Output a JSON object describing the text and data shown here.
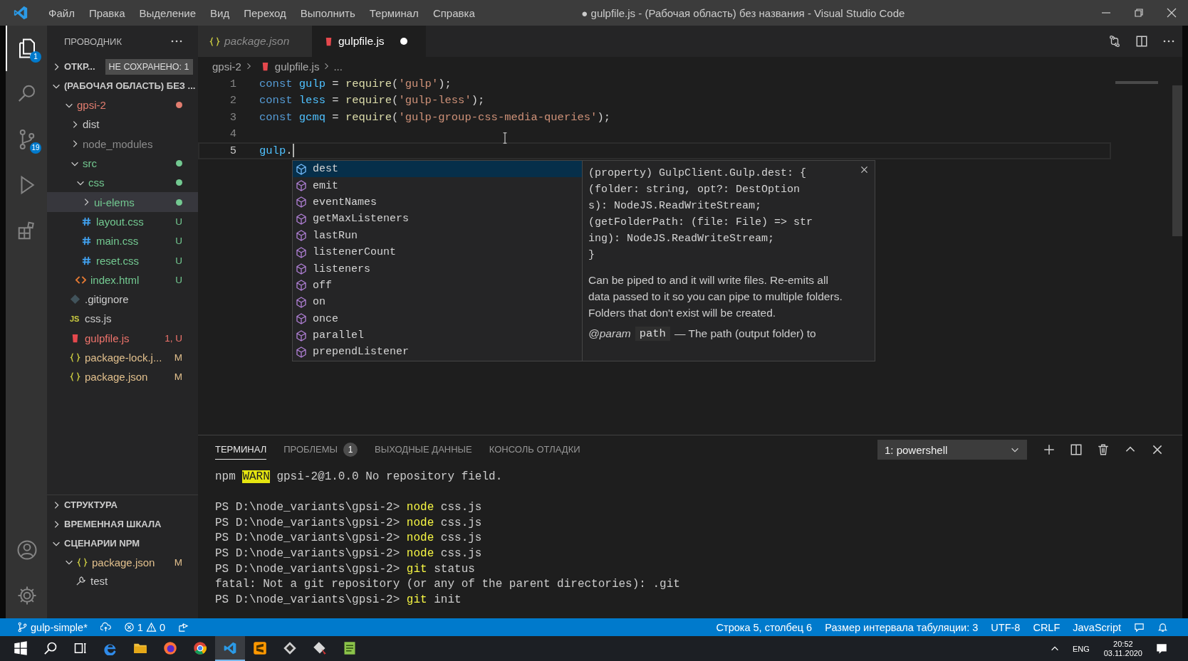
{
  "window": {
    "title": "● gulpfile.js - (Рабочая область) без названия - Visual Studio Code"
  },
  "menu": [
    "Файл",
    "Правка",
    "Выделение",
    "Вид",
    "Переход",
    "Выполнить",
    "Терминал",
    "Справка"
  ],
  "activity_bar": [
    {
      "kind": "explorer",
      "selected": true,
      "badge": "1"
    },
    {
      "kind": "search",
      "selected": false
    },
    {
      "kind": "source-control",
      "selected": false,
      "badge": "19"
    },
    {
      "kind": "run",
      "selected": false
    },
    {
      "kind": "extensions",
      "selected": false
    }
  ],
  "activity_bar_bottom": [
    {
      "kind": "account"
    },
    {
      "kind": "settings"
    }
  ],
  "sidebar": {
    "title": "ПРОВОДНИК",
    "open_editors": {
      "label": "ОТКР...",
      "expanded": false,
      "badge": "НЕ СОХРАНЕНО: 1"
    },
    "workspace": {
      "label": "(РАБОЧАЯ ОБЛАСТЬ) БЕЗ ...",
      "expanded": true
    },
    "tree": [
      {
        "name": "gpsi-2",
        "kind": "folder",
        "expanded": true,
        "selected": false,
        "color": "#e27d6f",
        "dot": true,
        "children": [
          {
            "name": "dist",
            "kind": "folder",
            "expanded": false,
            "selected": false,
            "color": "#cccccc"
          },
          {
            "name": "node_modules",
            "kind": "folder",
            "expanded": false,
            "selected": false,
            "color": "#8c8c8c"
          },
          {
            "name": "src",
            "kind": "folder",
            "expanded": true,
            "selected": false,
            "color": "#73c991",
            "dot": true,
            "children": [
              {
                "name": "css",
                "kind": "folder",
                "expanded": true,
                "selected": false,
                "color": "#73c991",
                "dot": true,
                "children": [
                  {
                    "name": "ui-elems",
                    "kind": "folder",
                    "expanded": false,
                    "selected": true,
                    "color": "#73c991",
                    "dot": true
                  },
                  {
                    "name": "layout.css",
                    "kind": "css",
                    "selected": false,
                    "color": "#73c991",
                    "status": "U"
                  },
                  {
                    "name": "main.css",
                    "kind": "css",
                    "selected": false,
                    "color": "#73c991",
                    "status": "U"
                  },
                  {
                    "name": "reset.css",
                    "kind": "css",
                    "selected": false,
                    "color": "#73c991",
                    "status": "U"
                  }
                ]
              },
              {
                "name": "index.html",
                "kind": "html",
                "selected": false,
                "color": "#73c991",
                "status": "U"
              }
            ]
          },
          {
            "name": ".gitignore",
            "kind": "git",
            "selected": false,
            "color": "#cccccc"
          },
          {
            "name": "css.js",
            "kind": "js",
            "icon_text": "JS",
            "selected": false,
            "color": "#cccccc"
          },
          {
            "name": "gulpfile.js",
            "kind": "gulp",
            "selected": false,
            "color": "#f0746c",
            "status": "1, U"
          },
          {
            "name": "package-lock.j...",
            "kind": "json",
            "selected": false,
            "color": "#e2c08d",
            "status": "M"
          },
          {
            "name": "package.json",
            "kind": "json",
            "selected": false,
            "color": "#e2c08d",
            "status": "M"
          }
        ]
      }
    ],
    "sections": [
      {
        "label": "СТРУКТУРА",
        "expanded": false
      },
      {
        "label": "ВРЕМЕННАЯ ШКАЛА",
        "expanded": false
      },
      {
        "label": "СЦЕНАРИИ NPM",
        "expanded": true,
        "children": [
          {
            "name": "package.json",
            "kind": "json",
            "expanded": true,
            "selected": false,
            "color": "#e2c08d",
            "status": "M",
            "children": [
              {
                "name": "test",
                "kind": "script",
                "selected": false,
                "color": "#cccccc"
              }
            ]
          }
        ]
      }
    ]
  },
  "tabs": [
    {
      "label": "package.json",
      "kind": "json",
      "preview": true,
      "selected": false
    },
    {
      "label": "gulpfile.js",
      "kind": "gulp",
      "preview": false,
      "dirty": true,
      "selected": true
    }
  ],
  "breadcrumb": [
    {
      "label": "gpsi-2",
      "kind": "folder"
    },
    {
      "label": "gulpfile.js",
      "kind": "gulp"
    },
    {
      "label": "...",
      "kind": "more"
    }
  ],
  "code": [
    {
      "number": "1",
      "current": false,
      "tokens": [
        {
          "text": "const ",
          "kind": "keyword"
        },
        {
          "text": "gulp",
          "kind": "variable"
        },
        {
          "text": " = ",
          "kind": "plain"
        },
        {
          "text": "require",
          "kind": "function"
        },
        {
          "text": "(",
          "kind": "plain"
        },
        {
          "text": "'gulp'",
          "kind": "string"
        },
        {
          "text": ");",
          "kind": "plain"
        }
      ]
    },
    {
      "number": "2",
      "current": false,
      "tokens": [
        {
          "text": "const ",
          "kind": "keyword"
        },
        {
          "text": "less",
          "kind": "variable"
        },
        {
          "text": " = ",
          "kind": "plain"
        },
        {
          "text": "require",
          "kind": "function"
        },
        {
          "text": "(",
          "kind": "plain"
        },
        {
          "text": "'gulp-less'",
          "kind": "string"
        },
        {
          "text": ");",
          "kind": "plain"
        }
      ]
    },
    {
      "number": "3",
      "current": false,
      "tokens": [
        {
          "text": "const ",
          "kind": "keyword"
        },
        {
          "text": "gcmq",
          "kind": "variable"
        },
        {
          "text": " = ",
          "kind": "plain"
        },
        {
          "text": "require",
          "kind": "function"
        },
        {
          "text": "(",
          "kind": "plain"
        },
        {
          "text": "'gulp-group-css-media-queries'",
          "kind": "string"
        },
        {
          "text": ");",
          "kind": "plain"
        }
      ]
    },
    {
      "number": "4",
      "current": false
    },
    {
      "number": "5",
      "current": true,
      "tokens": [
        {
          "text": "gulp",
          "kind": "variable"
        },
        {
          "text": ".",
          "kind": "plain"
        }
      ]
    }
  ],
  "suggest": {
    "items": [
      {
        "label": "dest",
        "selected": true
      },
      {
        "label": "emit",
        "selected": false
      },
      {
        "label": "eventNames",
        "selected": false
      },
      {
        "label": "getMaxListeners",
        "selected": false
      },
      {
        "label": "lastRun",
        "selected": false
      },
      {
        "label": "listenerCount",
        "selected": false
      },
      {
        "label": "listeners",
        "selected": false
      },
      {
        "label": "off",
        "selected": false
      },
      {
        "label": "on",
        "selected": false
      },
      {
        "label": "once",
        "selected": false
      },
      {
        "label": "parallel",
        "selected": false
      },
      {
        "label": "prependListener",
        "selected": false
      }
    ],
    "doc": {
      "signature": [
        "(property) GulpClient.Gulp.dest: {",
        "(folder: string, opt?: DestOption",
        "s): NodeJS.ReadWriteStream;",
        "(getFolderPath: (file: File) => str",
        "ing): NodeJS.ReadWriteStream;",
        "}"
      ],
      "description": "Can be piped to and it will write files. Re-emits all data passed to it so you can pipe to multiple folders. Folders that don't exist will be created.",
      "param": {
        "tag": "@param",
        "name": "path",
        "text": "— The path (output folder) to"
      }
    }
  },
  "panel": {
    "tabs": [
      {
        "label": "ТЕРМИНАЛ",
        "selected": true
      },
      {
        "label": "ПРОБЛЕМЫ",
        "badge": "1",
        "selected": false
      },
      {
        "label": "ВЫХОДНЫЕ ДАННЫЕ",
        "selected": false
      },
      {
        "label": "КОНСОЛЬ ОТЛАДКИ",
        "selected": false
      }
    ],
    "terminal_select": "1: powershell",
    "terminal": [
      {
        "kind": "output",
        "segments": [
          {
            "text": "npm ",
            "kind": "plain"
          },
          {
            "text": "WARN",
            "kind": "warn"
          },
          {
            "text": " gpsi-2@1.0.0 No repository field.",
            "kind": "plain"
          }
        ]
      },
      {
        "kind": "blank"
      },
      {
        "kind": "output",
        "segments": [
          {
            "text": "PS D:\\node_variants\\gpsi-2> ",
            "kind": "plain"
          },
          {
            "text": "node",
            "kind": "command"
          },
          {
            "text": " css.js",
            "kind": "plain"
          }
        ]
      },
      {
        "kind": "output",
        "segments": [
          {
            "text": "PS D:\\node_variants\\gpsi-2> ",
            "kind": "plain"
          },
          {
            "text": "node",
            "kind": "command"
          },
          {
            "text": " css.js",
            "kind": "plain"
          }
        ]
      },
      {
        "kind": "output",
        "segments": [
          {
            "text": "PS D:\\node_variants\\gpsi-2> ",
            "kind": "plain"
          },
          {
            "text": "node",
            "kind": "command"
          },
          {
            "text": " css.js",
            "kind": "plain"
          }
        ]
      },
      {
        "kind": "output",
        "segments": [
          {
            "text": "PS D:\\node_variants\\gpsi-2> ",
            "kind": "plain"
          },
          {
            "text": "node",
            "kind": "command"
          },
          {
            "text": " css.js",
            "kind": "plain"
          }
        ]
      },
      {
        "kind": "output",
        "segments": [
          {
            "text": "PS D:\\node_variants\\gpsi-2> ",
            "kind": "plain"
          },
          {
            "text": "git",
            "kind": "command"
          },
          {
            "text": " status",
            "kind": "plain"
          }
        ]
      },
      {
        "kind": "output",
        "segments": [
          {
            "text": "fatal: Not a git repository (or any of the parent directories): .git",
            "kind": "plain"
          }
        ]
      },
      {
        "kind": "output",
        "segments": [
          {
            "text": "PS D:\\node_variants\\gpsi-2> ",
            "kind": "plain"
          },
          {
            "text": "git",
            "kind": "command"
          },
          {
            "text": " init",
            "kind": "plain"
          }
        ]
      }
    ]
  },
  "status_bar": {
    "branch": "gulp-simple*",
    "errors": "1",
    "warnings": "0",
    "items": [
      "Строка 5, столбец 6",
      "Размер интервала табуляции: 3",
      "UTF-8",
      "CRLF",
      "JavaScript"
    ]
  },
  "taskbar": {
    "apps": [
      {
        "kind": "start",
        "selected": false
      },
      {
        "kind": "search",
        "selected": false
      },
      {
        "kind": "task-view",
        "selected": false
      },
      {
        "kind": "edge",
        "selected": false
      },
      {
        "kind": "explorer",
        "selected": false
      },
      {
        "kind": "firefox",
        "selected": false
      },
      {
        "kind": "chrome",
        "selected": false
      },
      {
        "kind": "vscode",
        "selected": true
      },
      {
        "kind": "sublime",
        "selected": false
      },
      {
        "kind": "diamond",
        "selected": false
      },
      {
        "kind": "diamond-tool",
        "selected": false
      },
      {
        "kind": "notepad",
        "selected": false
      }
    ],
    "language": "ENG",
    "time": "20:52",
    "date": "03.11.2020"
  }
}
